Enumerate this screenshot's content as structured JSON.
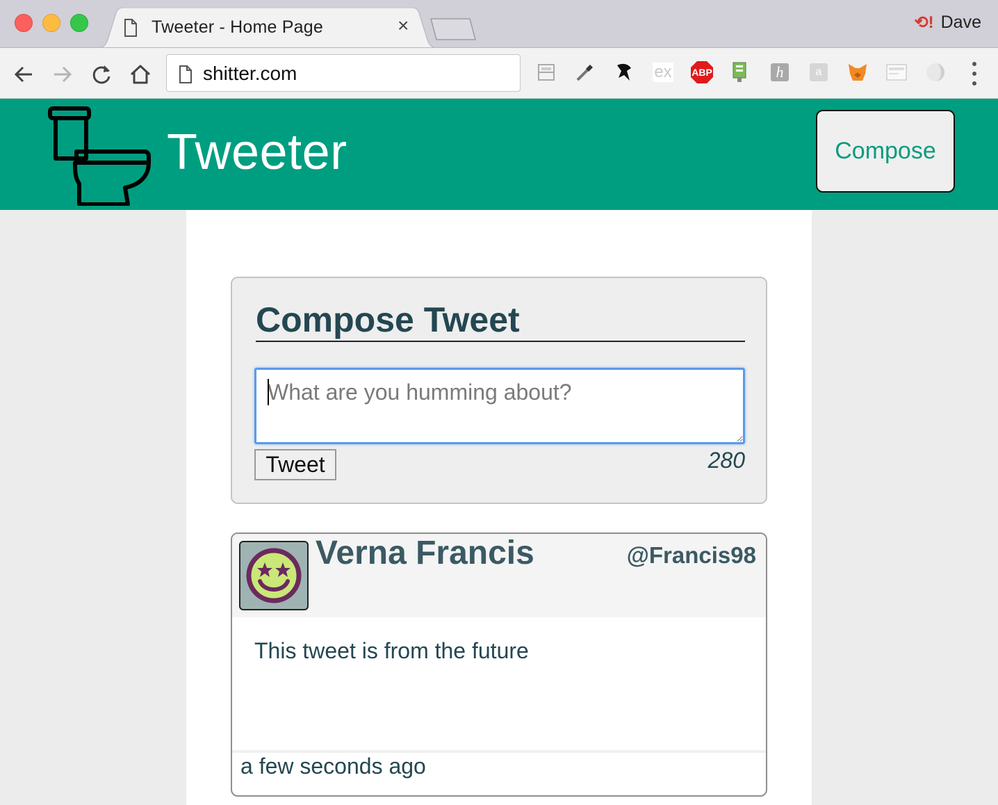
{
  "browser": {
    "tab_title": "Tweeter - Home Page",
    "tab_close": "×",
    "profile_name": "Dave",
    "url": "shitter.com",
    "extensions": [
      "layout-icon",
      "eyedropper-icon",
      "ninja-icon",
      "ex-icon",
      "adblock-plus-icon",
      "server-icon",
      "h-icon",
      "a-chat-icon",
      "metamask-fox-icon",
      "card-icon",
      "swirl-icon"
    ],
    "adblock_label": "ABP",
    "ex_label": "ex",
    "h_label": "h",
    "a_label": "a"
  },
  "header": {
    "title": "Tweeter",
    "compose_button": "Compose",
    "brand_color": "#009e80"
  },
  "compose": {
    "heading": "Compose Tweet",
    "placeholder": "What are you humming about?",
    "submit_label": "Tweet",
    "char_count": "280"
  },
  "tweets": [
    {
      "name": "Verna Francis",
      "handle": "@Francis98",
      "text": "This tweet is from the future",
      "time": "a few seconds ago"
    }
  ]
}
